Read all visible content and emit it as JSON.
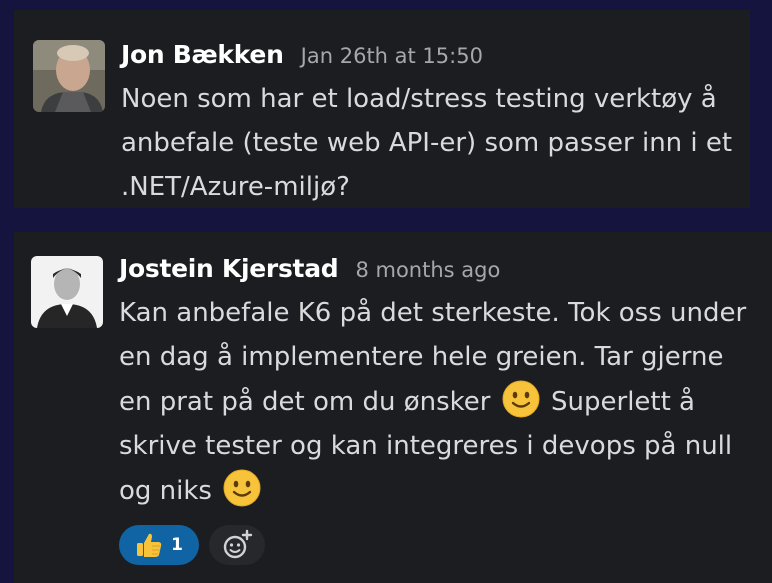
{
  "messages": [
    {
      "author": "Jon Bækken",
      "timestamp": "Jan 26th at 15:50",
      "text": "Noen som har et load/stress testing verktøy å anbefale (teste web API-er) som passer inn i et .NET/Azure-miljø?"
    },
    {
      "author": "Jostein Kjerstad",
      "timestamp": "8 months ago",
      "text_part1": "Kan anbefale K6 på det sterkeste. Tok oss under en dag å implementere hele greien. Tar gjerne en prat på det om du ønsker",
      "text_part2": "Superlett å skrive tester og kan integreres i devops på null og niks",
      "emoji": "slightly-smiling-face",
      "reactions": [
        {
          "emoji": "thumbs-up",
          "count": "1"
        }
      ],
      "add_reaction_icon": "add-reaction-icon"
    }
  ],
  "colors": {
    "background": "#14143f",
    "card": "#1b1d21",
    "author": "#ffffff",
    "timestamp": "#a6a7aa",
    "body_text": "#d9dadb",
    "reaction_pill": "#1164a3"
  }
}
